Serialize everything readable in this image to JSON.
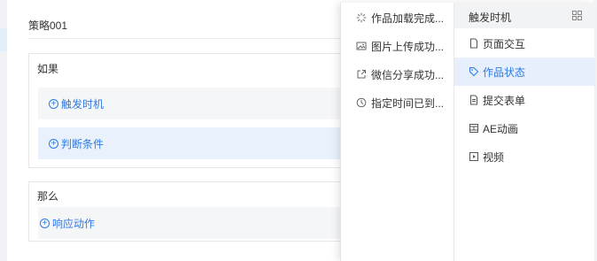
{
  "rule": {
    "title": "策略001",
    "if_label": "如果",
    "trigger_label": "触发时机",
    "condition_label": "判断条件",
    "then_label": "那么",
    "action_label": "响应动作",
    "add_icon": "plus-circle-icon"
  },
  "dropdown": {
    "options": [
      {
        "label": "作品加载完成...",
        "icon": "loading-icon"
      },
      {
        "label": "图片上传成功...",
        "icon": "image-icon"
      },
      {
        "label": "微信分享成功...",
        "icon": "share-icon"
      },
      {
        "label": "指定时间已到...",
        "icon": "clock-icon"
      }
    ],
    "category_title": "触发时机",
    "categories": [
      {
        "label": "页面交互",
        "icon": "page-icon",
        "active": false
      },
      {
        "label": "作品状态",
        "icon": "tag-icon",
        "active": true
      },
      {
        "label": "提交表单",
        "icon": "form-icon",
        "active": false
      },
      {
        "label": "AE动画",
        "icon": "animation-icon",
        "active": false
      },
      {
        "label": "视频",
        "icon": "video-icon",
        "active": false
      }
    ]
  },
  "colors": {
    "accent": "#2f7ae5",
    "active_bg": "#e6effb",
    "row_bg": "#f5f6f8"
  }
}
